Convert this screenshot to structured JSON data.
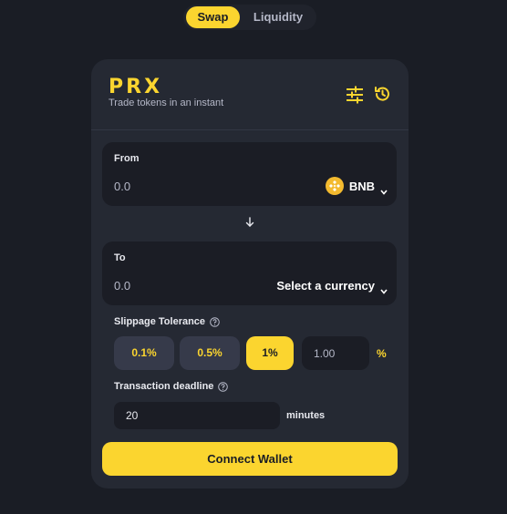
{
  "tabs": [
    {
      "label": "Swap",
      "active": true
    },
    {
      "label": "Liquidity",
      "active": false
    }
  ],
  "header": {
    "logo": "PRX",
    "subtitle": "Trade tokens in an instant",
    "icons": [
      "settings-sliders-icon",
      "history-icon"
    ]
  },
  "from": {
    "label": "From",
    "amount": "0.0",
    "currency": "BNB",
    "currency_icon": "bnb-token-icon"
  },
  "to": {
    "label": "To",
    "amount": "0.0",
    "currency_prompt": "Select a currency"
  },
  "slippage": {
    "label": "Slippage Tolerance",
    "options": [
      "0.1%",
      "0.5%",
      "1%"
    ],
    "selected": "1%",
    "custom_value": "1.00",
    "unit": "%"
  },
  "deadline": {
    "label": "Transaction deadline",
    "value": "20",
    "unit": "minutes"
  },
  "connect_label": "Connect Wallet",
  "colors": {
    "background": "#1a1d25",
    "card": "#252933",
    "accent": "#fbd52f",
    "input": "#1b1d25",
    "pill": "#363a4a",
    "muted_text": "#b5b8c8"
  }
}
